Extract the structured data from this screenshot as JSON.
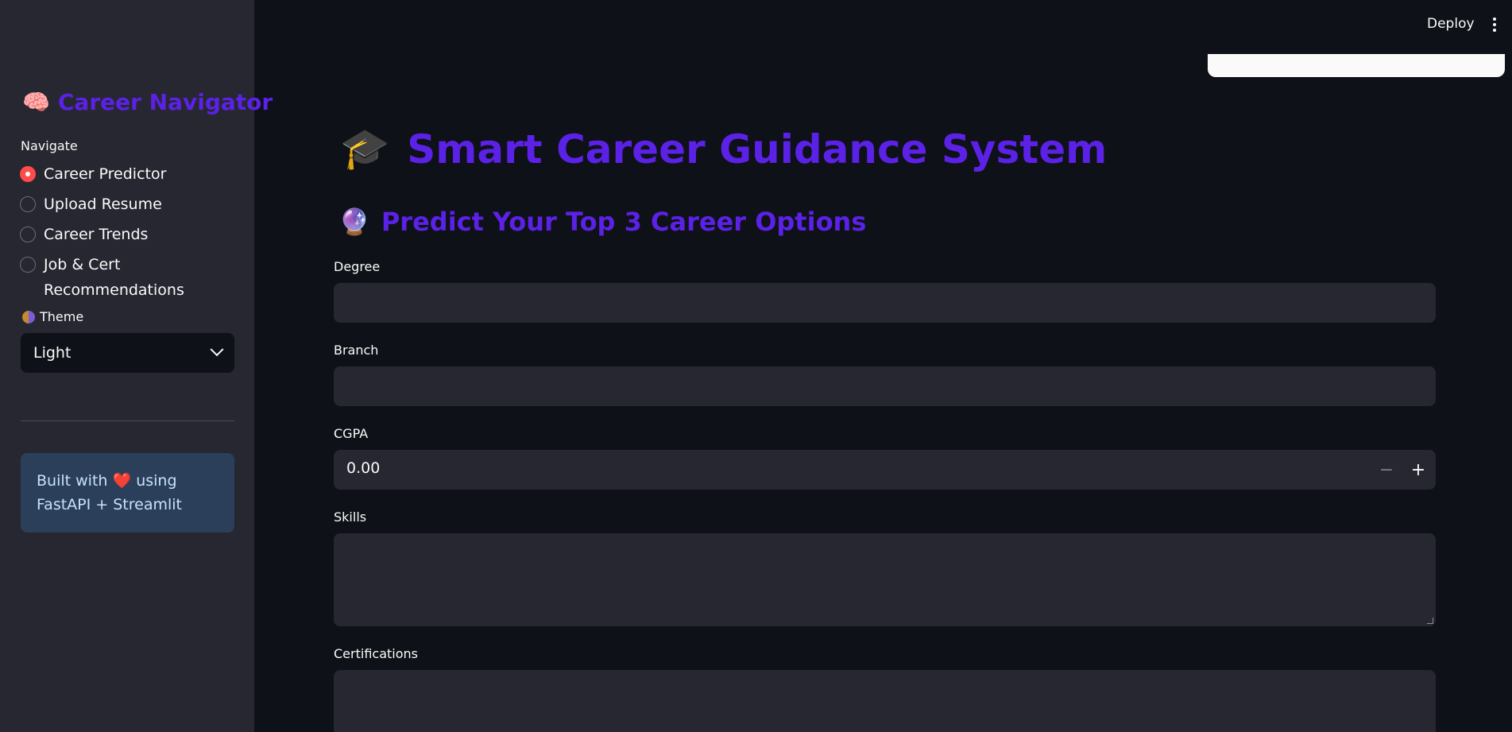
{
  "header": {
    "deploy_label": "Deploy"
  },
  "sidebar": {
    "brand_emoji": "🧠",
    "brand_title": "Career Navigator",
    "navigate_label": "Navigate",
    "nav_items": [
      {
        "label": "Career Predictor",
        "selected": true
      },
      {
        "label": "Upload Resume",
        "selected": false
      },
      {
        "label": "Career Trends",
        "selected": false
      },
      {
        "label": "Job & Cert Recommendations",
        "selected": false
      }
    ],
    "theme_label": "Theme",
    "theme_value": "Light",
    "info_text_1": "Built with",
    "info_heart": "❤️",
    "info_text_2": "using FastAPI + Streamlit"
  },
  "main": {
    "title_emoji": "🎓",
    "title": "Smart Career Guidance System",
    "subtitle_emoji": "🔮",
    "subtitle": "Predict Your Top 3 Career Options",
    "fields": {
      "degree_label": "Degree",
      "degree_value": "",
      "branch_label": "Branch",
      "branch_value": "",
      "cgpa_label": "CGPA",
      "cgpa_value": "0.00",
      "skills_label": "Skills",
      "skills_value": "",
      "certifications_label": "Certifications",
      "certifications_value": ""
    },
    "stepper_minus": "−",
    "stepper_plus": "+"
  },
  "colors": {
    "accent": "#5b21e6",
    "radio_selected": "#ff4b4b",
    "sidebar_bg": "#262730",
    "main_bg": "#0e1117",
    "info_bg": "#2b3f5a"
  }
}
